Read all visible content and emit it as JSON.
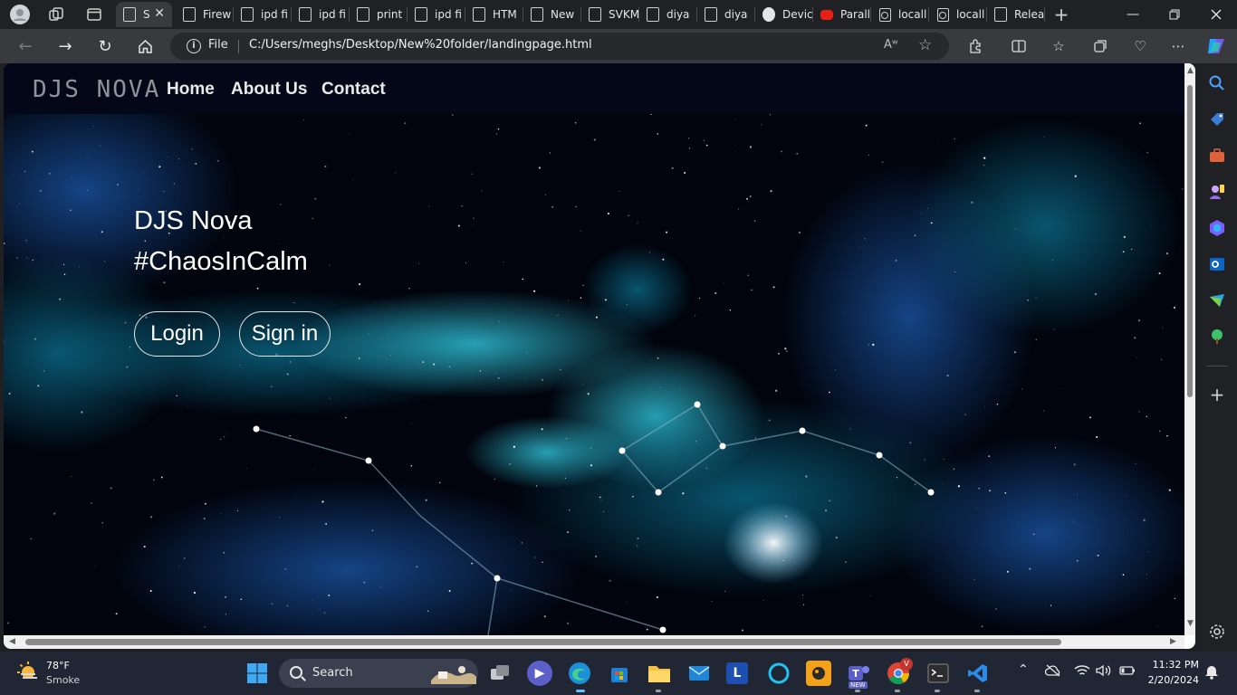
{
  "browser": {
    "tabs": [
      {
        "label": "S",
        "icon": "page-icon",
        "active": true
      },
      {
        "label": "Firew",
        "icon": "page-icon"
      },
      {
        "label": "ipd fi",
        "icon": "page-icon"
      },
      {
        "label": "ipd fi",
        "icon": "page-icon"
      },
      {
        "label": "print",
        "icon": "page-icon"
      },
      {
        "label": "ipd fi",
        "icon": "page-icon"
      },
      {
        "label": "HTM",
        "icon": "page-icon"
      },
      {
        "label": "New",
        "icon": "new-tab-icon"
      },
      {
        "label": "SVKM",
        "icon": "page-icon"
      },
      {
        "label": "diya",
        "icon": "page-icon"
      },
      {
        "label": "diya",
        "icon": "page-icon"
      },
      {
        "label": "Devic",
        "icon": "github-icon"
      },
      {
        "label": "Parall",
        "icon": "youtube-icon"
      },
      {
        "label": "locall",
        "icon": "localhost-icon"
      },
      {
        "label": "locall",
        "icon": "localhost-icon"
      },
      {
        "label": "Relea",
        "icon": "page-icon"
      }
    ],
    "address": {
      "scheme_label": "File",
      "url": "C:/Users/meghs/Desktop/New%20folder/landingpage.html"
    }
  },
  "page": {
    "brand": "DJS NOVA",
    "nav": [
      "Home",
      "About Us",
      "Contact"
    ],
    "hero": {
      "title": "DJS Nova",
      "tagline": "#ChaosInCalm",
      "login_label": "Login",
      "signin_label": "Sign in"
    },
    "colors": {
      "background": "#01030b",
      "navbar": "#030717",
      "nebula_cyan": "#1fb6d6",
      "nebula_blue": "#1d4fa8"
    }
  },
  "taskbar": {
    "weather": {
      "temp": "78°F",
      "condition": "Smoke"
    },
    "search_label": "Search",
    "clock": {
      "time": "11:32 PM",
      "date": "2/20/2024"
    },
    "chrome_badge": "V",
    "teams_badge": "NEW"
  }
}
